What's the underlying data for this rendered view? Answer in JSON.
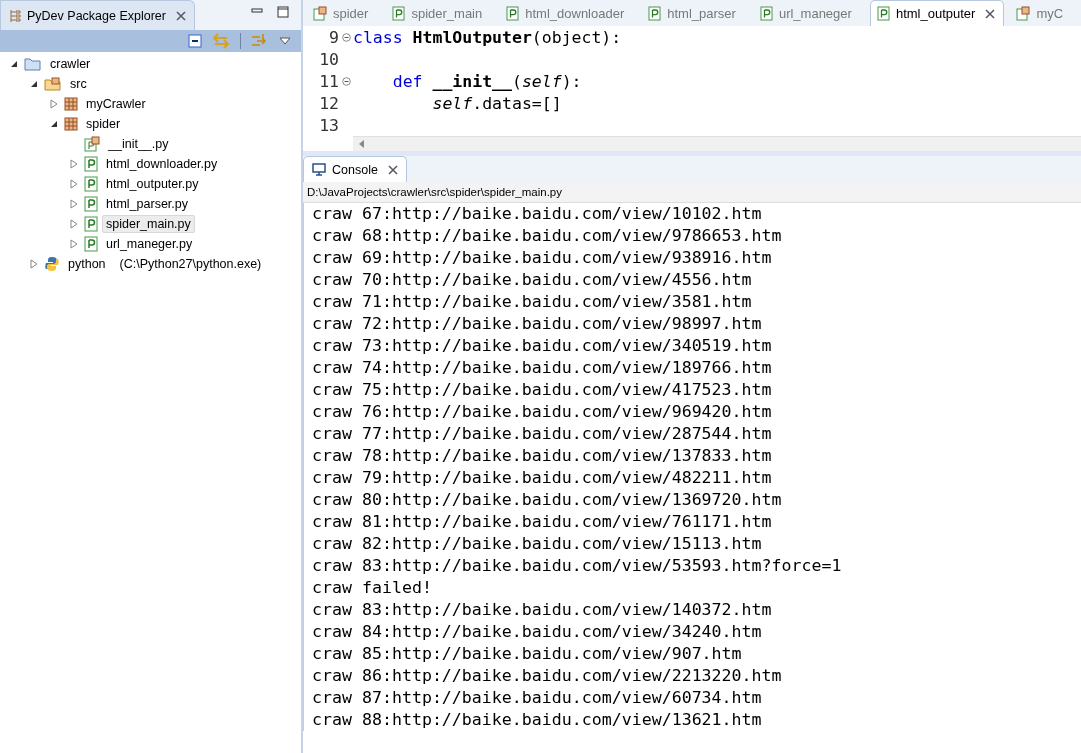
{
  "explorer": {
    "title": "PyDev Package Explorer",
    "tree": [
      {
        "label": "crawler",
        "kind": "project",
        "expanded": true,
        "selected": false,
        "children": [
          {
            "label": "src",
            "kind": "source-folder",
            "expanded": true,
            "selected": false,
            "children": [
              {
                "label": "myCrawler",
                "kind": "package",
                "expanded": false,
                "selected": false
              },
              {
                "label": "spider",
                "kind": "package",
                "expanded": true,
                "selected": false,
                "children": [
                  {
                    "label": "__init__.py",
                    "kind": "init",
                    "selected": false
                  },
                  {
                    "label": "html_downloader.py",
                    "kind": "module",
                    "expanded": false,
                    "selected": false
                  },
                  {
                    "label": "html_outputer.py",
                    "kind": "module",
                    "expanded": false,
                    "selected": false
                  },
                  {
                    "label": "html_parser.py",
                    "kind": "module",
                    "expanded": false,
                    "selected": false
                  },
                  {
                    "label": "spider_main.py",
                    "kind": "module",
                    "expanded": false,
                    "selected": true
                  },
                  {
                    "label": "url_maneger.py",
                    "kind": "module",
                    "expanded": false,
                    "selected": false
                  }
                ]
              }
            ]
          },
          {
            "label": "python",
            "detail": "(C:\\Python27\\python.exe)",
            "kind": "interpreter",
            "expanded": false,
            "selected": false
          }
        ]
      }
    ]
  },
  "editor": {
    "tabs": [
      {
        "label": "spider",
        "kind": "package",
        "selected": false
      },
      {
        "label": "spider_main",
        "kind": "module",
        "selected": false
      },
      {
        "label": "html_downloader",
        "kind": "module",
        "selected": false
      },
      {
        "label": "html_parser",
        "kind": "module",
        "selected": false
      },
      {
        "label": "url_maneger",
        "kind": "module",
        "selected": false
      },
      {
        "label": "html_outputer",
        "kind": "module",
        "selected": true
      },
      {
        "label": "myC",
        "kind": "package",
        "selected": false
      }
    ],
    "lines": [
      {
        "number": "9",
        "kind": "fold",
        "tokens": [
          {
            "kind": "keyword",
            "text": "class "
          },
          {
            "kind": "name",
            "text": "HtmlOutputer"
          },
          {
            "kind": "plain",
            "text": "(object):"
          }
        ]
      },
      {
        "number": "10",
        "kind": "plain"
      },
      {
        "number": "11",
        "kind": "fold",
        "tokens": [
          {
            "kind": "keyword",
            "text": "    def "
          },
          {
            "kind": "name",
            "text": "__init__"
          },
          {
            "kind": "plain",
            "text": "("
          },
          {
            "kind": "self",
            "text": "self"
          },
          {
            "kind": "plain",
            "text": "):"
          }
        ]
      },
      {
        "number": "12",
        "kind": "plain",
        "tokens": [
          {
            "kind": "self",
            "text": "        self"
          },
          {
            "kind": "plain",
            "text": ".datas=[]"
          }
        ]
      },
      {
        "number": "13",
        "kind": "plain"
      }
    ]
  },
  "console": {
    "title": "Console",
    "path": "D:\\JavaProjects\\crawler\\src\\spider\\spider_main.py",
    "lines": [
      "craw 67:http://baike.baidu.com/view/10102.htm",
      "craw 68:http://baike.baidu.com/view/9786653.htm",
      "craw 69:http://baike.baidu.com/view/938916.htm",
      "craw 70:http://baike.baidu.com/view/4556.htm",
      "craw 71:http://baike.baidu.com/view/3581.htm",
      "craw 72:http://baike.baidu.com/view/98997.htm",
      "craw 73:http://baike.baidu.com/view/340519.htm",
      "craw 74:http://baike.baidu.com/view/189766.htm",
      "craw 75:http://baike.baidu.com/view/417523.htm",
      "craw 76:http://baike.baidu.com/view/969420.htm",
      "craw 77:http://baike.baidu.com/view/287544.htm",
      "craw 78:http://baike.baidu.com/view/137833.htm",
      "craw 79:http://baike.baidu.com/view/482211.htm",
      "craw 80:http://baike.baidu.com/view/1369720.htm",
      "craw 81:http://baike.baidu.com/view/761171.htm",
      "craw 82:http://baike.baidu.com/view/15113.htm",
      "craw 83:http://baike.baidu.com/view/53593.htm?force=1",
      "craw failed!",
      "craw 83:http://baike.baidu.com/view/140372.htm",
      "craw 84:http://baike.baidu.com/view/34240.htm",
      "craw 85:http://baike.baidu.com/view/907.htm",
      "craw 86:http://baike.baidu.com/view/2213220.htm",
      "craw 87:http://baike.baidu.com/view/60734.htm",
      "craw 88:http://baike.baidu.com/view/13621.htm"
    ]
  }
}
